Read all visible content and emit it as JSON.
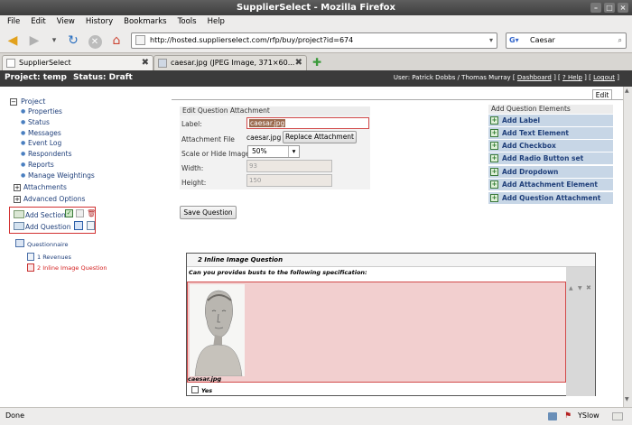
{
  "window": {
    "title": "SupplierSelect - Mozilla Firefox"
  },
  "menu": [
    "File",
    "Edit",
    "View",
    "History",
    "Bookmarks",
    "Tools",
    "Help"
  ],
  "nav": {
    "url": "http://hosted.supplierselect.com/rfp/buy/project?id=674",
    "search": "Caesar"
  },
  "tabs": [
    {
      "label": "SupplierSelect"
    },
    {
      "label": "caesar.jpg (JPEG Image, 371×60..."
    }
  ],
  "header": {
    "project": "Project: temp",
    "status": "Status: Draft",
    "user": "User: Patrick Dobbs / Thomas Murray",
    "links": [
      "Dashboard",
      "? Help",
      "Logout"
    ]
  },
  "sidebar": {
    "project": "Project",
    "sub": [
      "Properties",
      "Status",
      "Messages",
      "Event Log",
      "Respondents",
      "Reports",
      "Manage Weightings"
    ],
    "attachments": "Attachments",
    "advanced": "Advanced Options",
    "add_section": "Add Section",
    "add_question": "Add Question",
    "questionnaire": "Questionnaire",
    "q1": "1 Revenues",
    "q2": "2 Inline Image Question"
  },
  "edit_tab": "Edit",
  "form": {
    "title": "Edit Question Attachment",
    "label_lbl": "Label:",
    "label_val": "caesar.jpg",
    "attach_lbl": "Attachment File",
    "attach_val": "caesar.jpg",
    "replace_btn": "Replace Attachment",
    "scale_lbl": "Scale or Hide Image",
    "scale_val": "50%",
    "width_lbl": "Width:",
    "width_val": "93",
    "height_lbl": "Height:",
    "height_val": "150",
    "save_btn": "Save Question"
  },
  "elements": {
    "title": "Add Question Elements",
    "items": [
      "Add Label",
      "Add Text Element",
      "Add Checkbox",
      "Add Radio Button set",
      "Add Dropdown",
      "Add Attachment Element",
      "Add Question Attachment"
    ]
  },
  "preview": {
    "title": "2 Inline Image Question",
    "question": "Can you provides busts to the following specification:",
    "caption": "caesar.jpg",
    "checkbox": "Yes"
  },
  "status": {
    "left": "Done",
    "right": "YSlow"
  }
}
